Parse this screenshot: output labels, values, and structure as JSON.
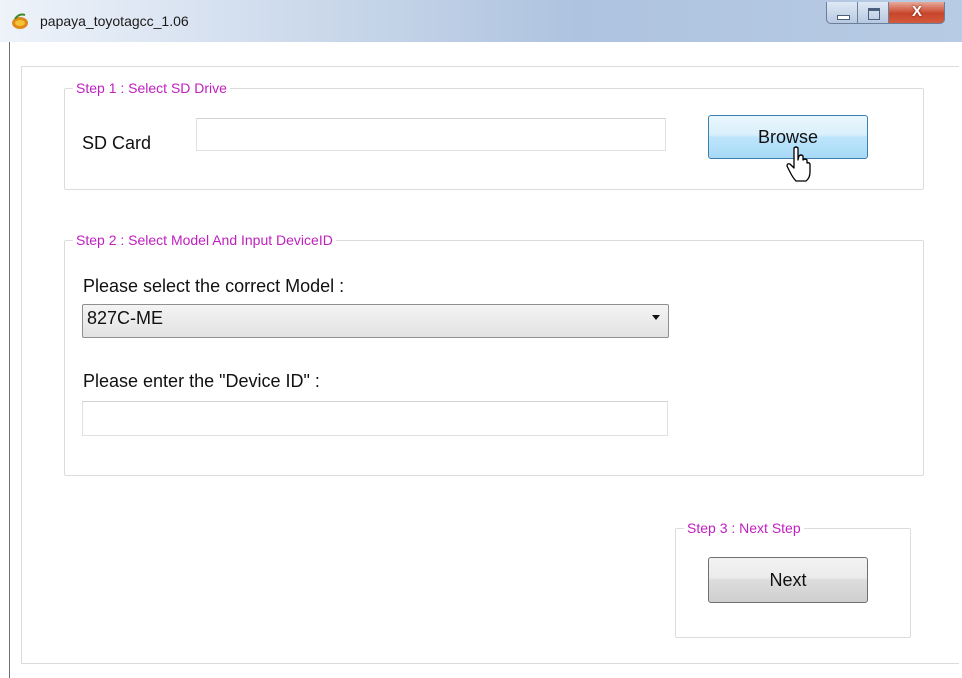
{
  "window": {
    "title": "papaya_toyotagcc_1.06",
    "close_glyph": "X",
    "icons": [
      "app-icon",
      "minimize-icon",
      "maximize-icon",
      "close-icon"
    ]
  },
  "step1": {
    "legend": "Step 1 : Select SD Drive",
    "sd_label": "SD Card",
    "sd_value": "",
    "browse_label": "Browse"
  },
  "step2": {
    "legend": "Step 2 : Select Model And Input DeviceID",
    "model_label": "Please select the correct Model :",
    "model_value": "827C-ME",
    "device_label": "Please enter the \"Device ID\" :",
    "device_value": ""
  },
  "step3": {
    "legend": "Step 3 : Next Step",
    "next_label": "Next"
  },
  "colors": {
    "legend_text": "#c020c0",
    "browse_accent": "#bee6fd",
    "close_button": "#c8452a"
  },
  "cursor_icon": "hand-pointer-icon"
}
